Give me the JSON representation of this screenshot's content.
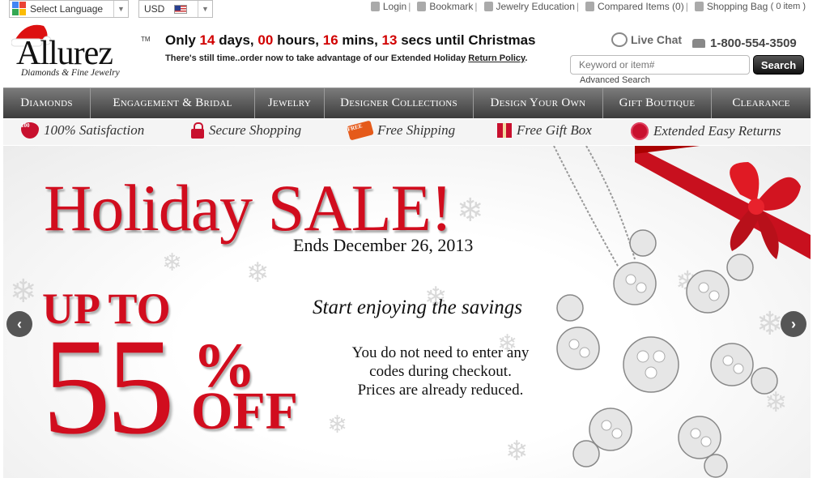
{
  "top_bar": {
    "language_label": "Select Language",
    "currency_label": "USD",
    "links": {
      "login": "Login",
      "bookmark": "Bookmark",
      "education": "Jewelry Education",
      "compared": "Compared Items (0)",
      "bag": "Shopping Bag",
      "bag_count": "( 0 item )"
    }
  },
  "logo": {
    "name": "Allurez",
    "tm": "TM",
    "tagline": "Diamonds & Fine Jewelry"
  },
  "countdown": {
    "prefix": "Only",
    "days": "14",
    "days_label": "days,",
    "hours": "00",
    "hours_label": "hours,",
    "mins": "16",
    "mins_label": "mins,",
    "secs": "13",
    "secs_label": "secs until Christmas",
    "notice": "There's still time..order now to take advantage of our Extended Holiday",
    "notice_link": "Return Policy",
    "notice_end": "."
  },
  "contact": {
    "chat": "Live Chat",
    "phone": "1-800-554-3509"
  },
  "search": {
    "placeholder": "Keyword or item#",
    "button": "Search",
    "advanced": "Advanced Search"
  },
  "nav": {
    "items": [
      "Diamonds",
      "Engagement & Bridal",
      "Jewelry",
      "Designer Collections",
      "Design Your Own",
      "Gift Boutique",
      "Clearance"
    ]
  },
  "features": {
    "satisfaction": "100% Satisfaction",
    "satisfaction_badge": "100",
    "secure": "Secure Shopping",
    "shipping": "Free Shipping",
    "shipping_badge": "FREE",
    "gift": "Free Gift Box",
    "returns": "Extended Easy Returns"
  },
  "banner": {
    "title": "Holiday SALE!",
    "ends": "Ends December 26, 2013",
    "up_to": "UP TO",
    "amount": "55",
    "percent": "%",
    "off": "OFF",
    "savings": "Start enjoying the savings",
    "desc_lines": [
      "You do not need to enter any",
      "codes during checkout.",
      "Prices are already reduced."
    ],
    "prev": "‹",
    "next": "›"
  },
  "colors": {
    "accent_red": "#d10d1e",
    "nav_dark": "#3c3c3c"
  }
}
